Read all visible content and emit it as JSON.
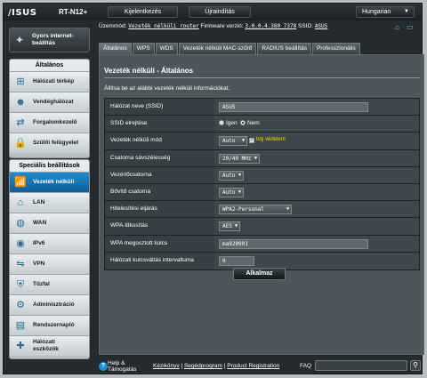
{
  "header": {
    "logo": "/ISUS",
    "model": "RT-N12+",
    "logout_label": "Kijelentkezés",
    "reboot_label": "Újraindítás",
    "language": "Hungarian"
  },
  "status": {
    "mode_label": "Üzemmód:",
    "mode_value": "Vezeték nélküli router",
    "firmware_label": "Firmware verzió:",
    "firmware_value": "3.0.0.4.380_7378",
    "ssid_label": "SSID:",
    "ssid_value": "ASUS"
  },
  "sidebar": {
    "quick_setup": "Gyors internet-beállítás",
    "general_header": "Általános",
    "general_items": [
      {
        "label": "Hálózati térkép",
        "icon": "network-map-icon"
      },
      {
        "label": "Vendéghálózat",
        "icon": "guest-network-icon"
      },
      {
        "label": "Forgalomkezelő",
        "icon": "traffic-manager-icon"
      },
      {
        "label": "Szülői felügyelet",
        "icon": "parental-control-icon"
      }
    ],
    "advanced_header": "Speciális beállítások",
    "advanced_items": [
      {
        "label": "Vezeték nélküli",
        "icon": "wireless-icon"
      },
      {
        "label": "LAN",
        "icon": "lan-icon"
      },
      {
        "label": "WAN",
        "icon": "wan-icon"
      },
      {
        "label": "IPv6",
        "icon": "ipv6-icon"
      },
      {
        "label": "VPN",
        "icon": "vpn-icon"
      },
      {
        "label": "Tűzfal",
        "icon": "firewall-icon"
      },
      {
        "label": "Adminisztráció",
        "icon": "administration-icon"
      },
      {
        "label": "Rendszernapló",
        "icon": "system-log-icon"
      },
      {
        "label": "Hálózati eszközök",
        "icon": "network-tools-icon"
      }
    ]
  },
  "tabs": [
    "Általános",
    "WPS",
    "WDS",
    "Vezeték nélküli MAC-szűrő",
    "RADIUS beállítás",
    "Professzionális"
  ],
  "main": {
    "title": "Vezeték nélküli - Általános",
    "info": "Állítsa be az alábbi vezeték nélküli információkat.",
    "fields": {
      "ssid_label": "Hálózat neve (SSID)",
      "ssid_value": "ASUS",
      "hide_label": "SSID elrejtése",
      "hide_yes": "Igen",
      "hide_no": "Nem",
      "mode_label": "Vezeték nélküli mód",
      "mode_value": "Auto",
      "bg_protection": "b/g védelem",
      "bandwidth_label": "Csatorna sávszélesség",
      "bandwidth_value": "20/40 MHz",
      "control_channel_label": "Vezérlőcsatorna",
      "control_channel_value": "Auto",
      "ext_channel_label": "Bővítő csatorna",
      "ext_channel_value": "Auto",
      "auth_label": "Hitelesítési eljárás",
      "auth_value": "WPA2-Personal",
      "encryption_label": "WPA-titkosítás",
      "encryption_value": "AES",
      "psk_label": "WPA megosztott kulcs",
      "psk_value": "ma920901",
      "rotation_label": "Hálózati kulcsváltás intervalluma",
      "rotation_value": "0"
    },
    "apply_label": "Alkalmaz"
  },
  "footer": {
    "help_line1": "Help &",
    "help_line2": "Támogatás",
    "manual": "Kézikönyv",
    "separator": "|",
    "utility": "Segédprogram",
    "product_reg": "Product Registration",
    "faq": "FAQ"
  }
}
